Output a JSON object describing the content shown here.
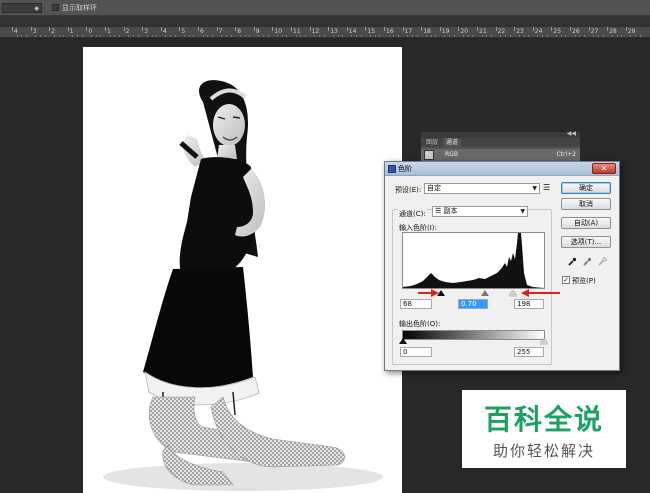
{
  "options_bar": {
    "checkbox_label": "显示取样环"
  },
  "ruler": {
    "labels": [
      "4",
      "3",
      "2",
      "1",
      "0",
      "1",
      "2",
      "3",
      "4",
      "5",
      "6",
      "7",
      "8",
      "9",
      "10",
      "11",
      "12",
      "13",
      "14",
      "15",
      "16",
      "17",
      "18",
      "19",
      "20",
      "21",
      "22",
      "23",
      "24",
      "25",
      "26",
      "27",
      "28",
      "29"
    ]
  },
  "panel": {
    "tabs": [
      "图层",
      "通道"
    ],
    "channel_name": "RGB",
    "channel_shortcut": "Ctrl+2"
  },
  "levels_dialog": {
    "title": "色阶",
    "close_glyph": "✕",
    "preset_label": "预设(E):",
    "preset_value": "自定",
    "channel_label": "通道(C):",
    "channel_value": "副本",
    "input_levels_label": "输入色阶(I):",
    "input_black": "68",
    "input_gamma": "0.70",
    "input_white": "198",
    "output_levels_label": "输出色阶(O):",
    "output_black": "0",
    "output_white": "255",
    "buttons": {
      "ok": "确定",
      "cancel": "取消",
      "auto": "自动(A)",
      "options": "选项(T)..."
    },
    "preview_label": "预览(P)",
    "preview_checked": true
  },
  "watermark": {
    "title": "百科全说",
    "subtitle": "助你轻松解决"
  },
  "colors": {
    "ps_dark": "#282828",
    "dialog_bg": "#f0f0f0",
    "arrow_red": "#e0201c",
    "watermark_green": "#1ca260",
    "selection_blue": "#3399ff"
  }
}
